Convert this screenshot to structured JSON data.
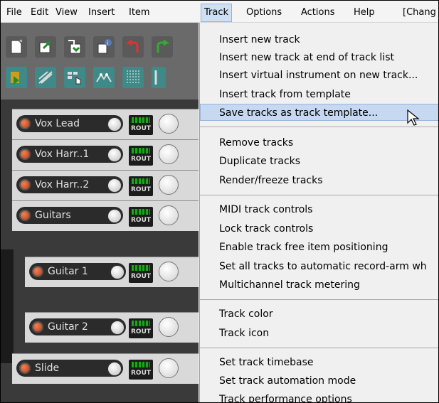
{
  "menubar": {
    "items": [
      "File",
      "Edit",
      "View",
      "Insert",
      "Item",
      "Track",
      "Options",
      "Actions",
      "Help",
      "[Chang"
    ],
    "active": "Track"
  },
  "toolbar": {
    "icons": [
      "new-project-icon",
      "open-project-icon",
      "save-project-icon",
      "project-info-icon",
      "undo-icon",
      "redo-icon",
      "grid-snap-icon",
      "ripple-edit-icon",
      "envelope-lock-icon",
      "auto-crossfade-icon",
      "metronome-icon",
      "grid-icon"
    ]
  },
  "tracks": [
    {
      "name": "Vox Lead",
      "route": "ROUT",
      "child": false
    },
    {
      "name": "Vox Harr..1",
      "route": "ROUT",
      "child": false
    },
    {
      "name": "Vox Harr..2",
      "route": "ROUT",
      "child": false
    },
    {
      "name": "Guitars",
      "route": "ROUT",
      "child": false
    },
    {
      "name": "Guitar 1",
      "route": "ROUT",
      "child": true
    },
    {
      "name": "Guitar 2",
      "route": "ROUT",
      "child": true
    },
    {
      "name": "Slide",
      "route": "ROUT",
      "child": false
    }
  ],
  "track_menu": {
    "groups": [
      [
        "Insert new track",
        "Insert new track at end of track list",
        "Insert virtual instrument on new track...",
        "Insert track from template",
        "Save tracks as track template..."
      ],
      [
        "Remove tracks",
        "Duplicate tracks",
        "Render/freeze tracks"
      ],
      [
        "MIDI track controls",
        "Lock track controls",
        "Enable track free item positioning",
        "Set all tracks to automatic record-arm wh",
        "Multichannel track metering"
      ],
      [
        "Track color",
        "Track icon"
      ],
      [
        "Set track timebase",
        "Set track automation mode",
        "Track performance options"
      ]
    ],
    "highlighted": "Save tracks as track template..."
  },
  "colors": {
    "menu_highlight": "#c6d9f0",
    "track_background": "#3a3a3a",
    "rec_arm": "#e06030",
    "route_meter": "#1aa81a"
  }
}
